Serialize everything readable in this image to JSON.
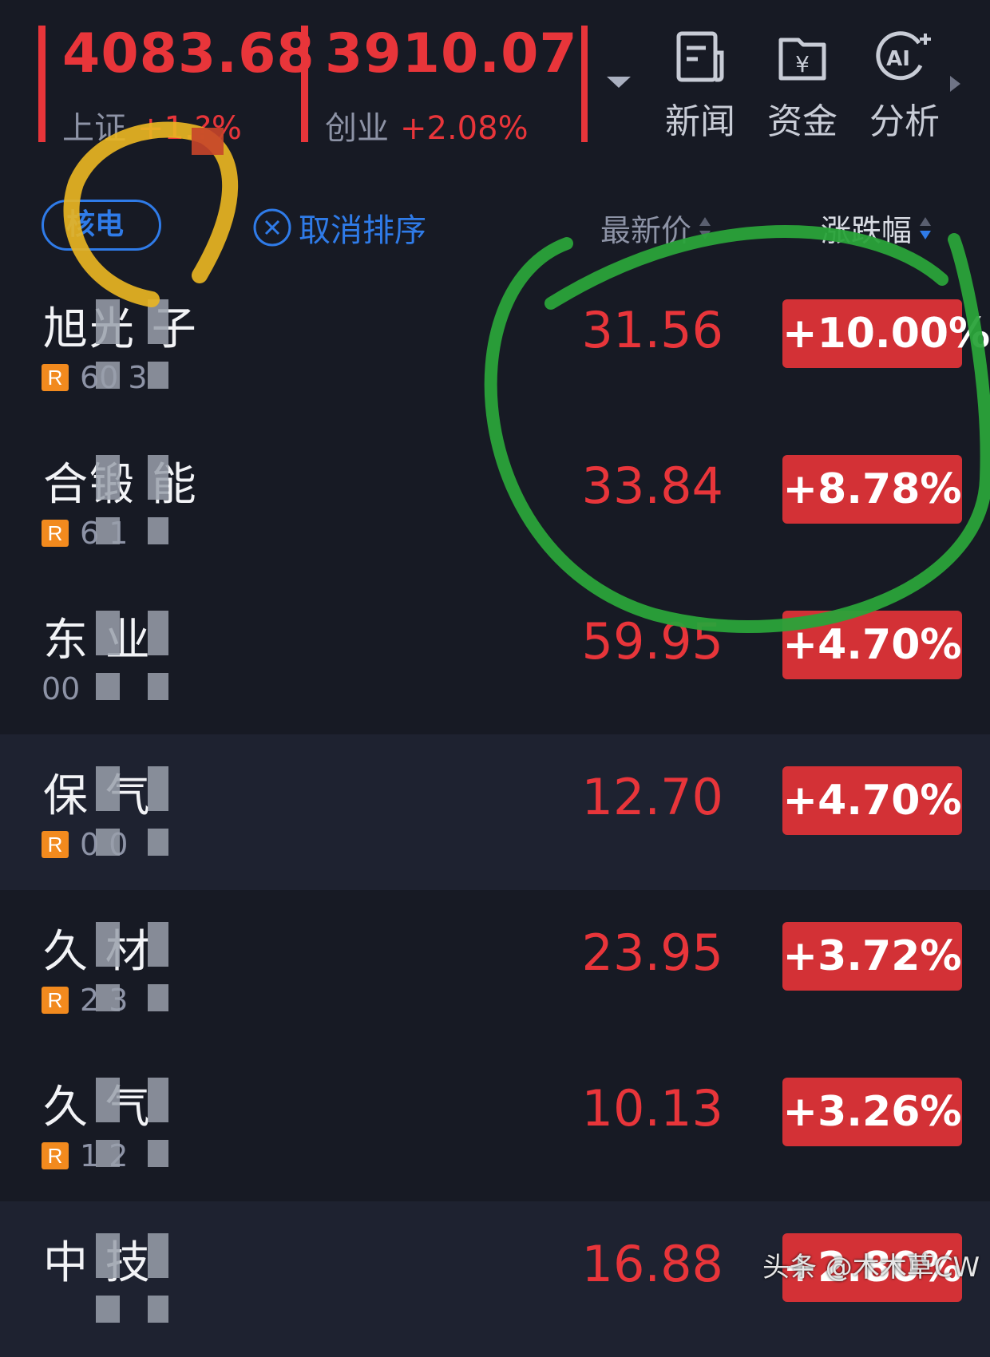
{
  "indices": [
    {
      "value": "4083.68",
      "name": "上证",
      "change": "+1.?%"
    },
    {
      "value": "3910.07",
      "name": "创业",
      "change": "+2.08%"
    }
  ],
  "tools": [
    {
      "label": "新闻",
      "icon": "news-icon"
    },
    {
      "label": "资金",
      "icon": "fund-icon"
    },
    {
      "label": "分析",
      "icon": "ai-analysis-icon"
    }
  ],
  "filter": {
    "tag": "核电",
    "cancel_sort": "取消排序"
  },
  "columns": {
    "price": "最新价",
    "change": "涨跌幅"
  },
  "stocks": [
    {
      "name": "旭光  子",
      "code": "60   3",
      "badge": "R",
      "price": "31.56",
      "change": "+10.00%"
    },
    {
      "name": "合锻  能",
      "code": "6    1",
      "badge": "R",
      "price": "33.84",
      "change": "+8.78%"
    },
    {
      "name": "东   业",
      "code": "00",
      "badge": "",
      "price": "59.95",
      "change": "+4.70%"
    },
    {
      "name": "保   气",
      "code": " 0  0",
      "badge": "R",
      "price": "12.70",
      "change": "+4.70%"
    },
    {
      "name": "久  材",
      "code": " 2  3",
      "badge": "R",
      "price": "23.95",
      "change": "+3.72%"
    },
    {
      "name": "久   气",
      "code": "  1  2",
      "badge": "R",
      "price": "10.13",
      "change": "+3.26%"
    },
    {
      "name": "中   技",
      "code": "",
      "badge": "",
      "price": "16.88",
      "change": "+2.80%"
    }
  ],
  "watermark": "头条 @木木草CW",
  "colors": {
    "up": "#e8353a",
    "badge": "#d33136",
    "accent": "#2f7be8",
    "background": "#171a24"
  }
}
